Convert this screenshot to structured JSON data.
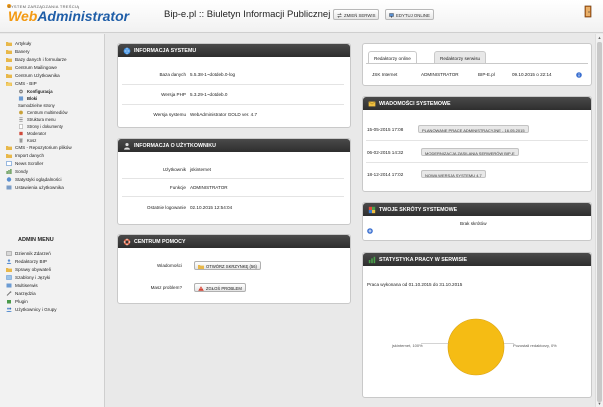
{
  "header": {
    "logo_small": "SYSTEM ZARZĄDZANIA TREŚCIĄ",
    "logo_web": "Web",
    "logo_admin": "Administrator",
    "site_title": "Bip-e.pl :: Biuletyn Informacji Publicznej ::",
    "change_service_label": "ZMIEŃ SERWIS",
    "edit_online_label": "EDYTUJ ONLINE"
  },
  "sidebar": {
    "items": [
      {
        "label": "Artykuły",
        "icon": "article-icon"
      },
      {
        "label": "Banery",
        "icon": "banner-icon"
      },
      {
        "label": "Bazy danych i formularze",
        "icon": "database-icon"
      },
      {
        "label": "Centrum Mailingowe",
        "icon": "mail-icon"
      },
      {
        "label": "Centrum Użytkownika",
        "icon": "user-icon"
      },
      {
        "label": "CMS - BIP",
        "icon": "cms-icon"
      },
      {
        "label": "Konfiguracja",
        "icon": "gear-icon"
      },
      {
        "label": "Bloki",
        "icon": "block-icon"
      },
      {
        "label": "Samodzielne strony",
        "icon": "page-icon"
      },
      {
        "label": "Centrum multimediów",
        "icon": "media-icon"
      },
      {
        "label": "Struktura menu",
        "icon": "menu-icon"
      },
      {
        "label": "Strony i dokumenty",
        "icon": "document-icon"
      },
      {
        "label": "Moderator",
        "icon": "moderator-icon"
      },
      {
        "label": "Kosz",
        "icon": "trash-icon"
      },
      {
        "label": "CMS - Repozytorium plików",
        "icon": "repository-icon"
      },
      {
        "label": "Import danych",
        "icon": "import-icon"
      },
      {
        "label": "News Scroller",
        "icon": "news-icon"
      },
      {
        "label": "Sondy",
        "icon": "poll-icon"
      },
      {
        "label": "Statystyki oglądalności",
        "icon": "stats-icon"
      },
      {
        "label": "Ustawienia użytkownika",
        "icon": "settings-icon"
      }
    ],
    "admin_menu_title": "ADMIN MENU",
    "admin_items": [
      {
        "label": "Dziennik Zdarzeń",
        "icon": "log-icon"
      },
      {
        "label": "Redaktorzy BIP",
        "icon": "editors-icon"
      },
      {
        "label": "Sprawy obywateli",
        "icon": "cases-icon"
      },
      {
        "label": "Szablony i Języki",
        "icon": "templates-icon"
      },
      {
        "label": "Multiserwis",
        "icon": "multiservice-icon"
      },
      {
        "label": "Narzędzia",
        "icon": "tools-icon"
      },
      {
        "label": "Plugin",
        "icon": "plugin-icon"
      },
      {
        "label": "Użytkownicy i Grupy",
        "icon": "users-groups-icon"
      }
    ]
  },
  "system_info": {
    "title": "INFORMACJA SYSTEMU",
    "rows": [
      {
        "label": "Baza danych",
        "value": "5.5.38-1~dotdeb.0-log"
      },
      {
        "label": "Wersja PHP",
        "value": "5.3.29-1~dotdeb.0"
      },
      {
        "label": "Wersja systemu",
        "value": "WebAdministrator GOLD ver. 4.7"
      }
    ]
  },
  "user_info": {
    "title": "INFORMACJA O UŻYTKOWNIKU",
    "rows": [
      {
        "label": "Użytkownik",
        "value": "jskinternet"
      },
      {
        "label": "Funkcje",
        "value": "ADMINISTRATOR"
      },
      {
        "label": "Ostatnie logowanie",
        "value": "02.10.2015 12:54:04"
      }
    ]
  },
  "help_center": {
    "title": "CENTRUM POMOCY",
    "messages_label": "Wiadomości",
    "inbox_button": "OTWÓRZ SKRZYNKĘ (56)",
    "problem_label": "Masz problem?",
    "report_button": "ZGŁOŚ PROBLEM"
  },
  "editors": {
    "tab_online": "Redaktorzy online",
    "tab_service": "Redaktorzy serwisu",
    "row": {
      "name": "JSK Internet",
      "role": "ADMINISTRATOR",
      "site": "BIP-E.pl",
      "time": "09.10.2015 o 22:14"
    }
  },
  "system_messages": {
    "title": "WIADOMOŚCI SYSTEMOWE",
    "items": [
      {
        "date": "15-05-2015 17:08",
        "text": "PLANOWANE PRACE ADMINISTRACYJNE - 16.05.2015"
      },
      {
        "date": "06-02-2015 14:32",
        "text": "MODERNIZACJA ZASILANIA SERWERÓW BIP-E"
      },
      {
        "date": "18-12-2014 17:02",
        "text": "NOWA WERSJA SYSTEMU 4.7"
      }
    ]
  },
  "shortcuts": {
    "title": "TWOJE SKRÓTY SYSTEMOWE",
    "empty_text": "Brak skrótów"
  },
  "stats": {
    "title": "STATYSTYKA PRACY W SERWISIE",
    "period": "Praca wykonana od 01.10.2015 do 31.10.2015",
    "slice_left_label": "jskinternet, 100%",
    "slice_right_label": "Pozostali redaktorzy, 0%",
    "pie_color": "#f5bc14"
  },
  "colors": {
    "accent_blue": "#1f5ea8",
    "accent_orange": "#f39a13",
    "panel_header": "#333333"
  }
}
